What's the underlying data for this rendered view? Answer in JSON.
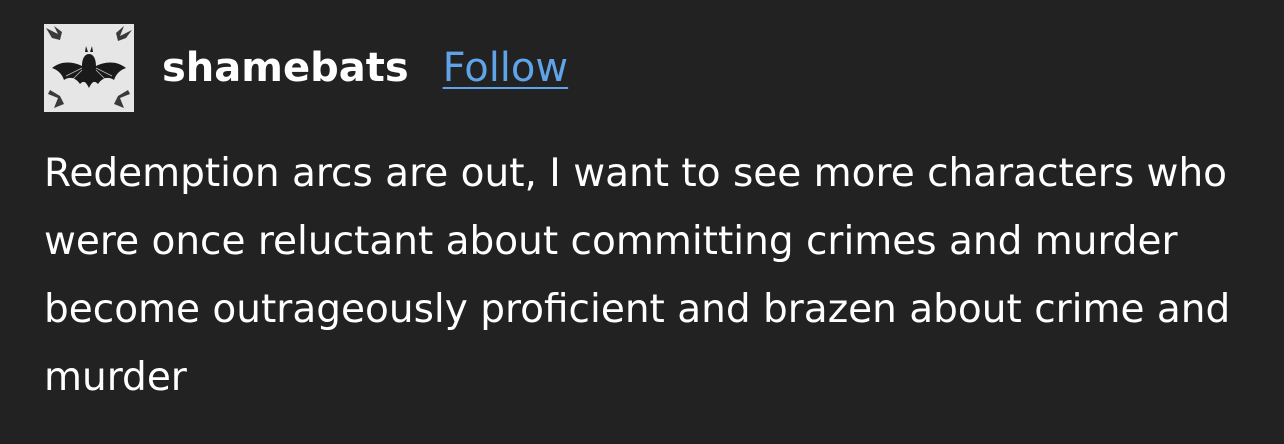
{
  "post": {
    "author": {
      "username": "shamebats",
      "avatar_icon": "bat-avatar-icon"
    },
    "follow_label": "Follow",
    "text": "Redemption arcs are out, I want to see more characters who were once reluctant about committing crimes and murder become outrageously proficient and brazen about crime and murder"
  },
  "colors": {
    "background": "#222222",
    "text": "#ffffff",
    "link": "#5fa4e8"
  }
}
